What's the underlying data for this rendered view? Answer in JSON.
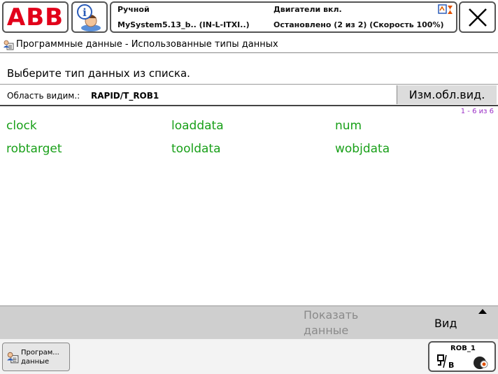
{
  "header": {
    "logo_text": "ABB",
    "mode": "Ручной",
    "system": "MySystem5.13_b.. (IN-L-ITXI..)",
    "motors": "Двигатели вкл.",
    "state": "Остановлено (2 из 2) (Скорость 100%)"
  },
  "window": {
    "title": "Программные данные - Использованные типы данных"
  },
  "instruction": "Выберите тип данных из списка.",
  "scope": {
    "label": "Область видим.:",
    "value": "RAPID/T_ROB1",
    "change_button": "Изм.обл.вид."
  },
  "list": {
    "page_count": "1 - 6 из 6",
    "items": [
      "clock",
      "loaddata",
      "num",
      "robtarget",
      "tooldata",
      "wobjdata"
    ]
  },
  "commandbar": {
    "show_data_line1": "Показать",
    "show_data_line2": "данные",
    "view": "Вид"
  },
  "taskbar": {
    "program_data_line1": "Програм...",
    "program_data_line2": "данные",
    "robot": "ROB_1"
  },
  "colors": {
    "item_green": "#19a019",
    "abb_red": "#e2001a",
    "page_count_purple": "#9b30c6"
  }
}
